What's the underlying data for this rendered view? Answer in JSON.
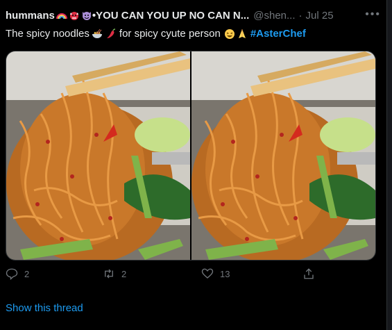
{
  "tweet": {
    "display_name": "hummans",
    "name_suffix": "•YOU CAN YOU UP NO CAN N...",
    "handle": "@shen...",
    "separator": "·",
    "date": "Jul 25",
    "more_icon": "more-dots-icon",
    "text_part1": "The spicy noodles",
    "text_part2": "for spicy cyute person",
    "hashtag": "#AsterChef"
  },
  "media": {
    "photos": [
      {
        "alt": "spicy noodles photo 1",
        "icon": "noodles-photo"
      },
      {
        "alt": "spicy noodles photo 2",
        "icon": "noodles-photo"
      }
    ]
  },
  "actions": {
    "reply_count": "2",
    "retweet_count": "2",
    "like_count": "13",
    "reply_icon": "reply-icon",
    "retweet_icon": "retweet-icon",
    "like_icon": "heart-icon",
    "share_icon": "share-icon"
  },
  "thread": {
    "label": "Show this thread"
  },
  "colors": {
    "accent": "#1d9bf0",
    "muted": "#71767b",
    "text": "#e7e9ea",
    "background": "#000000"
  }
}
